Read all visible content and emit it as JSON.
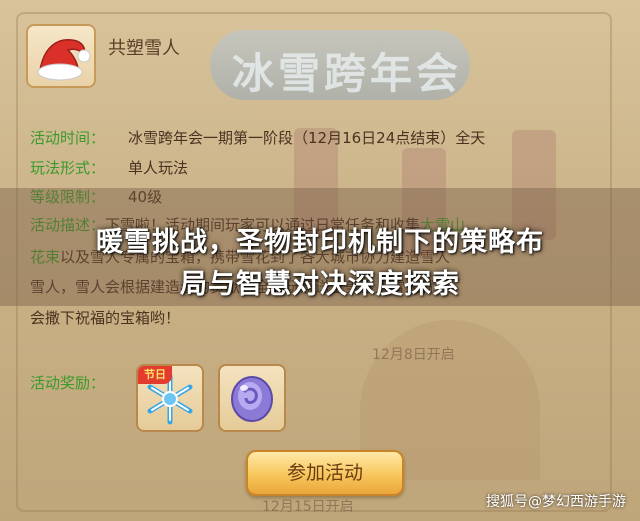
{
  "background": {
    "banner_text": "冰雪跨年会",
    "date_text": "12月8日开启",
    "bottom_date_text": "12月15日开启"
  },
  "character": {
    "name": "共塑雪人",
    "icon": "santa-hat-icon"
  },
  "info": {
    "time_label": "活动时间：",
    "time_value": "冰雪跨年会一期第一阶段（12月16日24点结束）全天",
    "mode_label": "玩法形式：",
    "mode_value": "单人玩法",
    "level_label": "等级限制：",
    "level_value": "40级"
  },
  "description": {
    "line1_label": "活动描述：",
    "line1_text": "下雪啦！活动期间玩家可以通过日常任务和收集",
    "line1_highlight": "大雪山",
    "line2_highlight": "花束",
    "line2_text": "以及雪人专属的宝箱，携带雪花到了各大城市协力建造雪人",
    "line3_text": "雪人，雪人会根据建造者的贡献为全服玩家送上美雪人雪人就",
    "line4_text": "会撒下祝福的宝箱哟！"
  },
  "headline": {
    "line1": "暖雪挑战，圣物封印机制下的策略布",
    "line2": "局与智慧对决深度探索"
  },
  "rewards": {
    "label": "活动奖励：",
    "items": [
      {
        "name": "snowflake-reward",
        "badge": "节日",
        "icon": "snowflake-icon"
      },
      {
        "name": "purple-stone-reward",
        "icon": "purple-stone-icon"
      }
    ]
  },
  "join_button": {
    "label": "参加活动"
  },
  "watermark": {
    "text": "搜狐号@梦幻西游手游"
  },
  "colors": {
    "label_green": "#3a9a2a",
    "text_brown": "#4a3220",
    "button_gold": "#f7c65c"
  }
}
